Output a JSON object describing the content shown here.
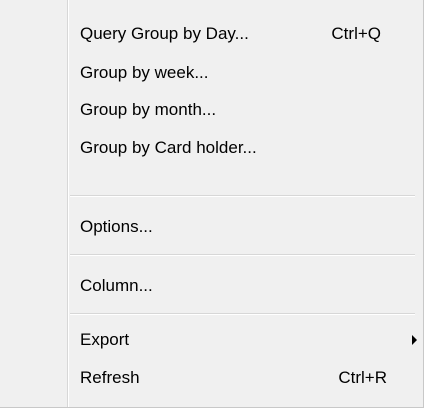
{
  "menu": {
    "items": [
      {
        "label": "Query Group by Day...",
        "shortcut": "Ctrl+Q"
      },
      {
        "label": "Group by week..."
      },
      {
        "label": "Group by month..."
      },
      {
        "label": "Group by Card holder..."
      },
      {
        "label": "Options..."
      },
      {
        "label": "Column..."
      },
      {
        "label": "Export",
        "submenu_icon": "submenu-arrow-icon"
      },
      {
        "label": "Refresh",
        "shortcut": "Ctrl+R"
      }
    ]
  }
}
